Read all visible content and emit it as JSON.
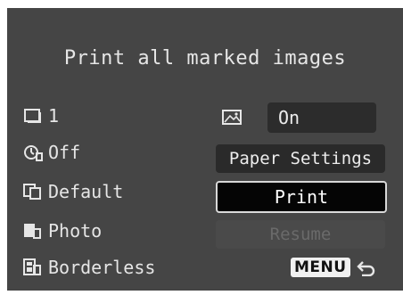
{
  "screen": {
    "title": "Print all marked images"
  },
  "settings": [
    {
      "icon": "copies-icon",
      "value": "1"
    },
    {
      "icon": "date-clock-icon",
      "value": "Off"
    },
    {
      "icon": "effects-icon",
      "value": "Default"
    },
    {
      "icon": "photo-type-icon",
      "value": "Photo"
    },
    {
      "icon": "layout-icon",
      "value": "Borderless"
    }
  ],
  "controls": {
    "picture_icon": "picture-icon",
    "value_label": "On",
    "paper_settings_label": "Paper Settings",
    "print_label": "Print",
    "resume_label": "Resume",
    "menu_label": "MENU",
    "return_icon": "return-arrow-icon"
  },
  "colors": {
    "background": "#454545",
    "text": "#e6e6e6",
    "selected_button": "#050505",
    "selected_border": "#d8d8d8",
    "disabled_text": "#6a6a6a"
  }
}
